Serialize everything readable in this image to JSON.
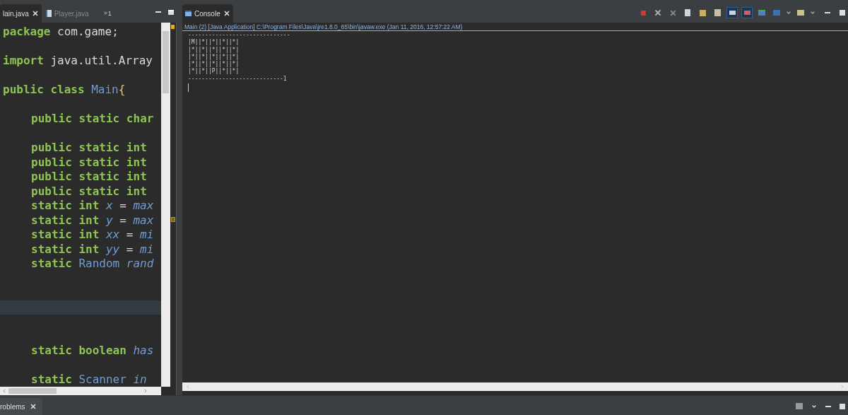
{
  "editor": {
    "tabs": [
      {
        "label": "lain.java",
        "selected": true,
        "closable": true
      },
      {
        "label": "Player.java",
        "selected": false,
        "closable": false
      }
    ],
    "overflow_count": "1",
    "lines": [
      {
        "kind": "code",
        "indented": false,
        "tokens": [
          {
            "kind": "keyword",
            "text": "package"
          },
          {
            "kind": "plain",
            "text": "com.game;"
          }
        ]
      },
      {
        "kind": "blank"
      },
      {
        "kind": "code",
        "indented": false,
        "tokens": [
          {
            "kind": "keyword",
            "text": "import"
          },
          {
            "kind": "plain",
            "text": "java.util.Array"
          }
        ]
      },
      {
        "kind": "blank"
      },
      {
        "kind": "code",
        "indented": false,
        "tokens": [
          {
            "kind": "keyword",
            "text": "public class"
          },
          {
            "kind": "type",
            "text": "Main"
          },
          {
            "kind": "bracket",
            "text": "{"
          }
        ]
      },
      {
        "kind": "blank"
      },
      {
        "kind": "code",
        "indented": true,
        "tokens": [
          {
            "kind": "keyword",
            "text": "public static char"
          }
        ]
      },
      {
        "kind": "blank"
      },
      {
        "kind": "code",
        "indented": true,
        "tokens": [
          {
            "kind": "keyword",
            "text": "public static int"
          }
        ]
      },
      {
        "kind": "code",
        "indented": true,
        "tokens": [
          {
            "kind": "keyword",
            "text": "public static int"
          }
        ]
      },
      {
        "kind": "code",
        "indented": true,
        "tokens": [
          {
            "kind": "keyword",
            "text": "public static int"
          }
        ]
      },
      {
        "kind": "code",
        "indented": true,
        "tokens": [
          {
            "kind": "keyword",
            "text": "public static int"
          }
        ]
      },
      {
        "kind": "code",
        "indented": true,
        "tokens": [
          {
            "kind": "keyword",
            "text": "static int"
          },
          {
            "kind": "field",
            "text": "x"
          },
          {
            "kind": "plain",
            "text": "="
          },
          {
            "kind": "field",
            "text": "max"
          }
        ]
      },
      {
        "kind": "code",
        "indented": true,
        "tokens": [
          {
            "kind": "keyword",
            "text": "static int"
          },
          {
            "kind": "field",
            "text": "y"
          },
          {
            "kind": "plain",
            "text": "="
          },
          {
            "kind": "field",
            "text": "max"
          }
        ]
      },
      {
        "kind": "code",
        "indented": true,
        "tokens": [
          {
            "kind": "keyword",
            "text": "static int"
          },
          {
            "kind": "field",
            "text": "xx"
          },
          {
            "kind": "plain",
            "text": "="
          },
          {
            "kind": "field",
            "text": "mi"
          }
        ]
      },
      {
        "kind": "code",
        "indented": true,
        "tokens": [
          {
            "kind": "keyword",
            "text": "static int"
          },
          {
            "kind": "field",
            "text": "yy"
          },
          {
            "kind": "plain",
            "text": "="
          },
          {
            "kind": "field",
            "text": "mi"
          }
        ]
      },
      {
        "kind": "code",
        "indented": true,
        "tokens": [
          {
            "kind": "keyword",
            "text": "static"
          },
          {
            "kind": "type",
            "text": "Random"
          },
          {
            "kind": "field",
            "text": "rand"
          }
        ]
      },
      {
        "kind": "blank"
      },
      {
        "kind": "blank"
      },
      {
        "kind": "current_line"
      },
      {
        "kind": "blank"
      },
      {
        "kind": "blank"
      },
      {
        "kind": "code",
        "indented": true,
        "tokens": [
          {
            "kind": "keyword",
            "text": "static boolean"
          },
          {
            "kind": "field",
            "text": "has"
          }
        ]
      },
      {
        "kind": "blank"
      },
      {
        "kind": "code",
        "indented": true,
        "tokens": [
          {
            "kind": "keyword",
            "text": "static"
          },
          {
            "kind": "type",
            "text": "Scanner"
          },
          {
            "kind": "field",
            "text": "in"
          }
        ]
      }
    ]
  },
  "console": {
    "tab": {
      "label": "Console",
      "selected": true
    },
    "process": "Main (2) [Java Application] C:\\Program Files\\Java\\jre1.8.0_65\\bin\\javaw.exe (Jan 11, 2016, 12:57:22 AM)",
    "output": [
      "------------------------------",
      "|M||*||*||*||*|",
      "|*||*||*||*||*|",
      "|*||*||*||*||*|",
      "|*||*||*||*||*|",
      "|*||*||P||*||*|",
      "----------------------------1"
    ]
  },
  "bottom": {
    "tab": {
      "label": "roblems",
      "selected": false
    }
  }
}
